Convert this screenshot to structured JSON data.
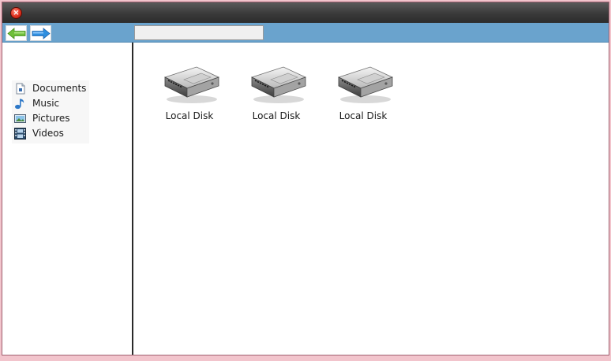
{
  "window": {
    "close_icon": "close-icon",
    "accent": "#6aa3cd",
    "titlebar_color": "#3a3a3a"
  },
  "toolbar": {
    "back_icon": "back-arrow-icon",
    "forward_icon": "forward-arrow-icon",
    "back_color": "#6fbf3a",
    "forward_color": "#2f8fe0",
    "address_value": "",
    "address_placeholder": ""
  },
  "sidebar": {
    "items": [
      {
        "label": "Documents",
        "icon": "document-icon"
      },
      {
        "label": "Music",
        "icon": "music-note-icon"
      },
      {
        "label": "Pictures",
        "icon": "picture-icon"
      },
      {
        "label": "Videos",
        "icon": "film-icon"
      }
    ]
  },
  "content": {
    "drives": [
      {
        "label": "Local Disk",
        "icon": "hard-drive-icon"
      },
      {
        "label": "Local Disk",
        "icon": "hard-drive-icon"
      },
      {
        "label": "Local Disk",
        "icon": "hard-drive-icon"
      }
    ]
  }
}
